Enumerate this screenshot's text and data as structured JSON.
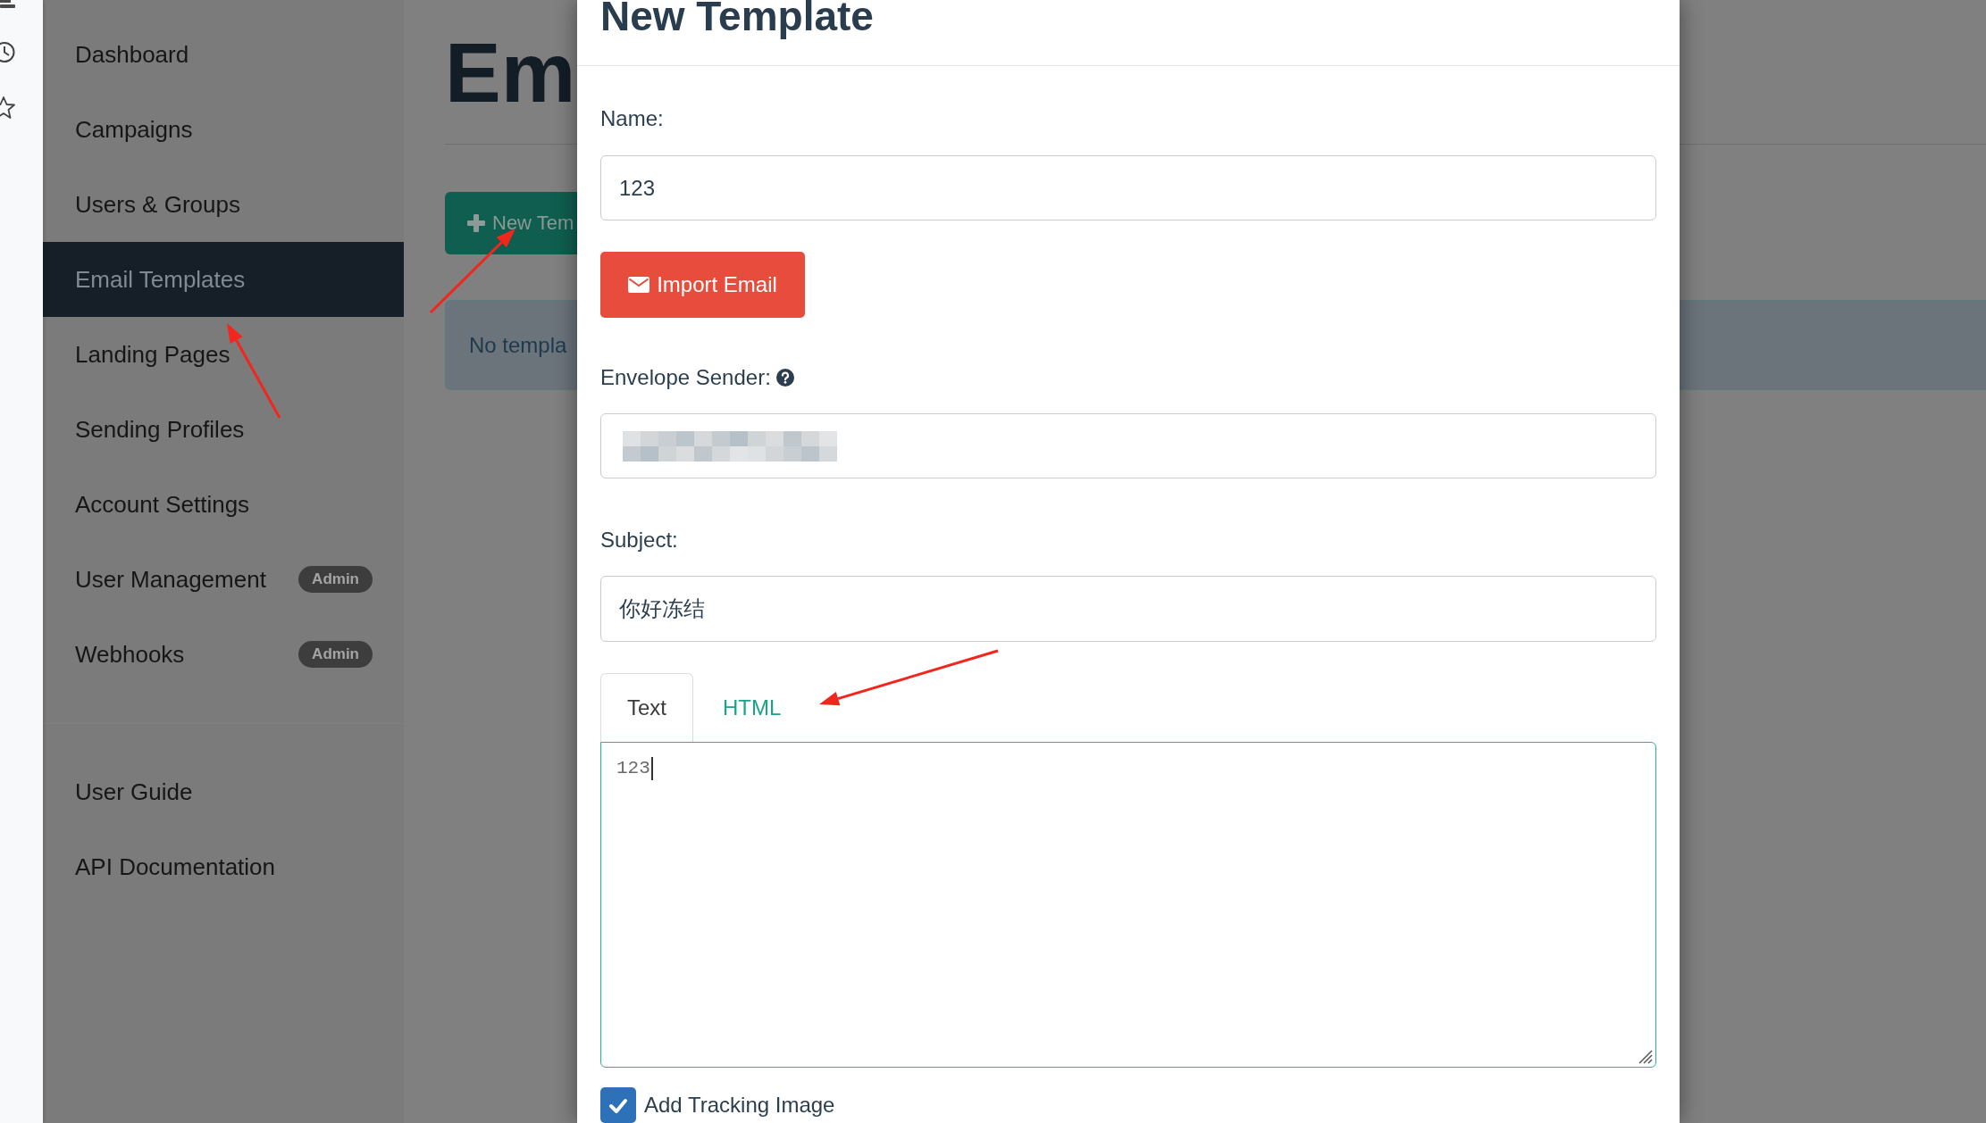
{
  "sidebar": {
    "items": [
      {
        "label": "Dashboard",
        "selected": false
      },
      {
        "label": "Campaigns",
        "selected": false
      },
      {
        "label": "Users & Groups",
        "selected": false
      },
      {
        "label": "Email Templates",
        "selected": true
      },
      {
        "label": "Landing Pages",
        "selected": false
      },
      {
        "label": "Sending Profiles",
        "selected": false
      },
      {
        "label": "Account Settings",
        "selected": false
      },
      {
        "label": "User Management",
        "selected": false,
        "badge": "Admin"
      },
      {
        "label": "Webhooks",
        "selected": false,
        "badge": "Admin"
      }
    ],
    "links": [
      {
        "label": "User Guide"
      },
      {
        "label": "API Documentation"
      }
    ]
  },
  "page": {
    "title": "Em",
    "new_button": "New Tem",
    "empty_message": "No templa"
  },
  "modal": {
    "title": "New Template",
    "name": {
      "label": "Name:",
      "value": "123"
    },
    "import_button": "Import Email",
    "envelope_sender": {
      "label": "Envelope Sender:",
      "value_redacted": true
    },
    "subject": {
      "label": "Subject:",
      "value": "你好冻结"
    },
    "tabs": [
      {
        "label": "Text",
        "selected": true
      },
      {
        "label": "HTML",
        "selected": false
      }
    ],
    "body": {
      "value": "123"
    },
    "tracking": {
      "label": "Add Tracking Image",
      "checked": true
    }
  }
}
